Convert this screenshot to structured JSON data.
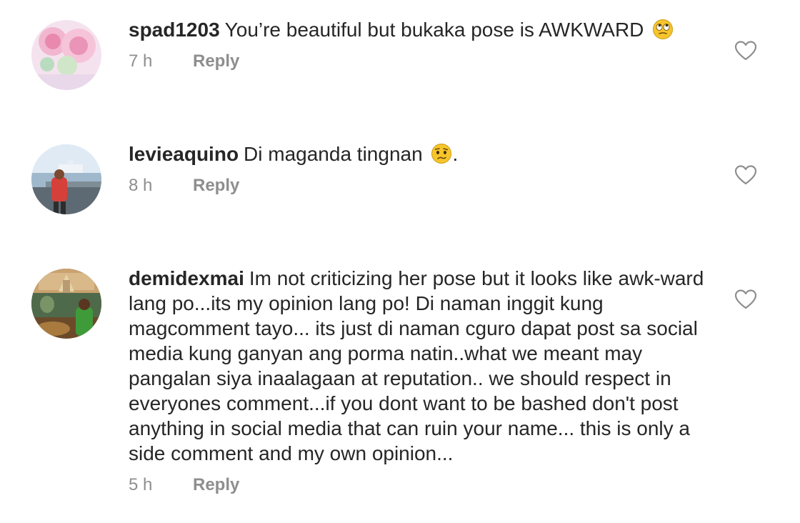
{
  "comments": [
    {
      "username": "spad1203",
      "text": "You’re beautiful but bukaka pose is AWKWARD",
      "emoji": "rolling-eyes-emoji",
      "time": "7 h",
      "reply_label": "Reply"
    },
    {
      "username": "levieaquino",
      "text": "Di maganda tingnan",
      "emoji": "confused-face-emoji",
      "text_after": ".",
      "time": "8 h",
      "reply_label": "Reply"
    },
    {
      "username": "demidexmai",
      "text": "Im not criticizing her pose but it looks like awk-ward lang po...its my opinion lang po! Di naman inggit kung magcomment tayo... its just di naman cguro dapat post sa social media kung ganyan ang porma natin..what we meant may pangalan siya inaalagaan at reputation.. we should respect in everyones comment...if you dont want to be bashed don't post anything in social media that can ruin your name... this is only a side comment and my own opinion...",
      "time": "5 h",
      "reply_label": "Reply"
    }
  ],
  "colors": {
    "text": "#262626",
    "secondary": "#8e8e8e",
    "background": "#ffffff"
  }
}
